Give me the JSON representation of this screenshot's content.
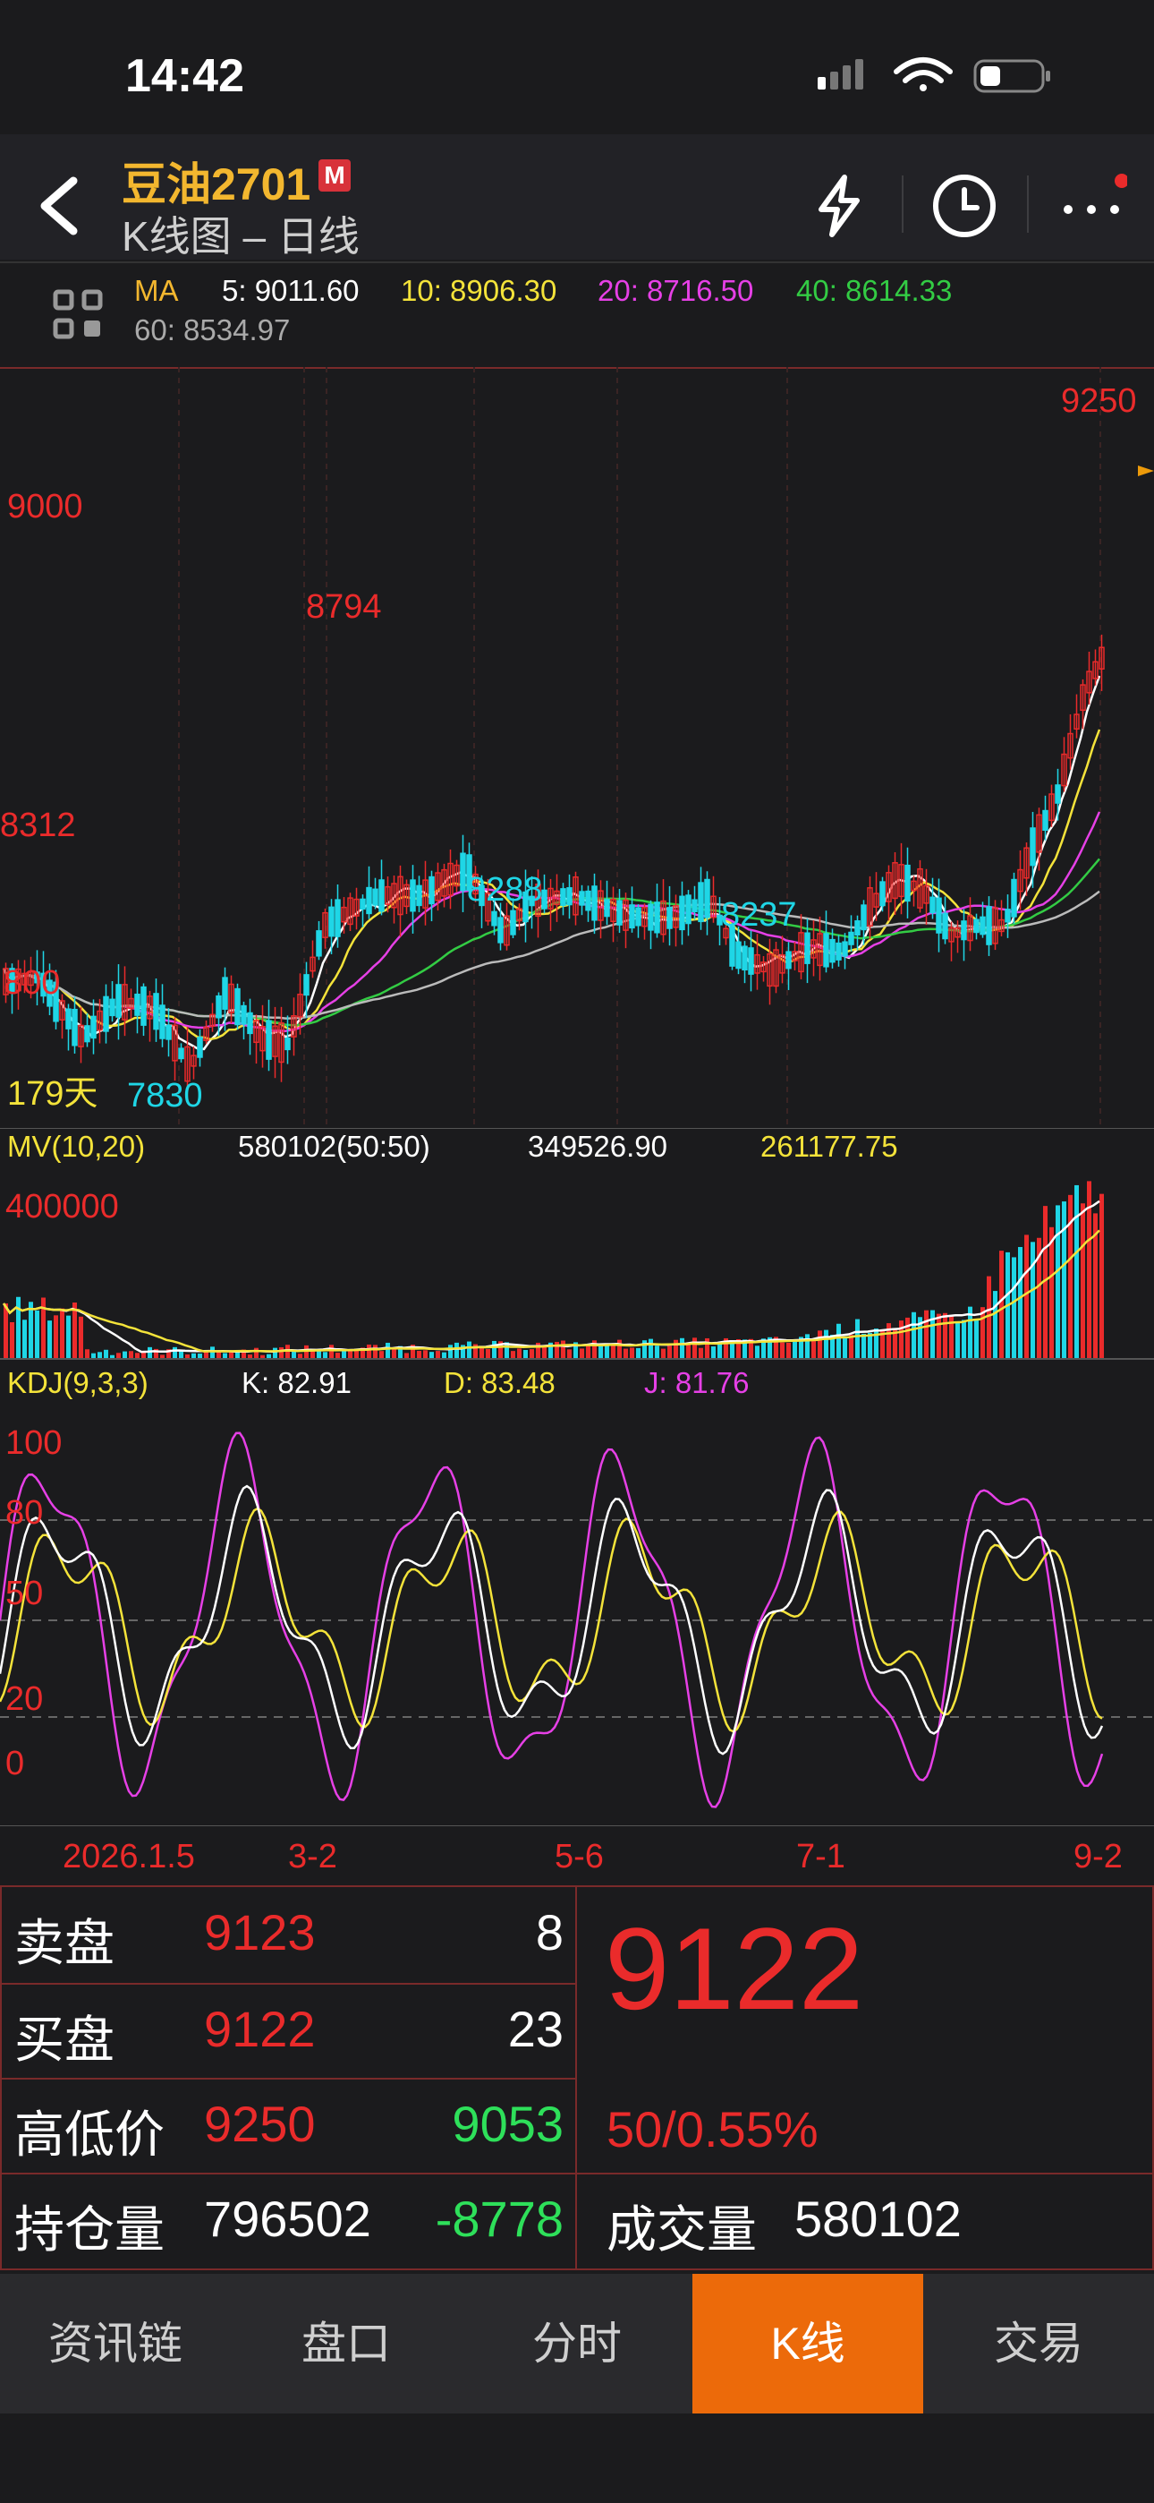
{
  "status": {
    "time": "14:42"
  },
  "header": {
    "title": "豆油2701",
    "badge": "M",
    "subtitle": "K线图 – 日线"
  },
  "ma": {
    "label": "MA",
    "ma5": "5: 9011.60",
    "ma10": "10: 8906.30",
    "ma20": "20: 8716.50",
    "ma40": "40: 8614.33",
    "ma60": "60: 8534.97"
  },
  "price_chart": {
    "y_labels": [
      "9000",
      "8312",
      "800"
    ],
    "high_label": "9250",
    "peak_label": "8794",
    "low_labels": [
      "8288",
      "8237",
      "7830"
    ],
    "days_label": "179天"
  },
  "volume": {
    "title": "MV(10,20)",
    "v1": "580102(50:50)",
    "v2": "349526.90",
    "v3": "261177.75",
    "y_label": "400000"
  },
  "kdj": {
    "title": "KDJ(9,3,3)",
    "k": "K: 82.91",
    "d": "D: 83.48",
    "j": "J: 81.76",
    "y_labels": [
      "100",
      "80",
      "50",
      "20",
      "0"
    ]
  },
  "x_axis": [
    "2026.1.5",
    "3-2",
    "5-6",
    "7-1",
    "9-2"
  ],
  "quote": {
    "ask_label": "卖盘",
    "ask_price": "9123",
    "ask_vol": "8",
    "bid_label": "买盘",
    "bid_price": "9122",
    "bid_vol": "23",
    "hl_label": "高低价",
    "high": "9250",
    "low": "9053",
    "oi_label": "持仓量",
    "oi": "796502",
    "oi_change": "-8778",
    "last": "9122",
    "change": "50/0.55%",
    "volume_label": "成交量",
    "volume": "580102"
  },
  "tabs": [
    "资讯链",
    "盘口",
    "分时",
    "K线",
    "交易"
  ],
  "colors": {
    "up": "#ea2b2b",
    "down": "#1fd6e6",
    "accent": "#ec6a0a",
    "title": "#f3b72f"
  },
  "chart_data": {
    "type": "candlestick",
    "ma_series": [
      {
        "name": "5",
        "value": 9011.6
      },
      {
        "name": "10",
        "value": 8906.3
      },
      {
        "name": "20",
        "value": 8716.5
      },
      {
        "name": "40",
        "value": 8614.33
      },
      {
        "name": "60",
        "value": 8534.97
      }
    ],
    "marked_prices": {
      "high": 9250,
      "peak": 8794,
      "troughs": [
        8288,
        8237,
        7830
      ]
    },
    "kdj": {
      "K": 82.91,
      "D": 83.48,
      "J": 81.76
    }
  }
}
